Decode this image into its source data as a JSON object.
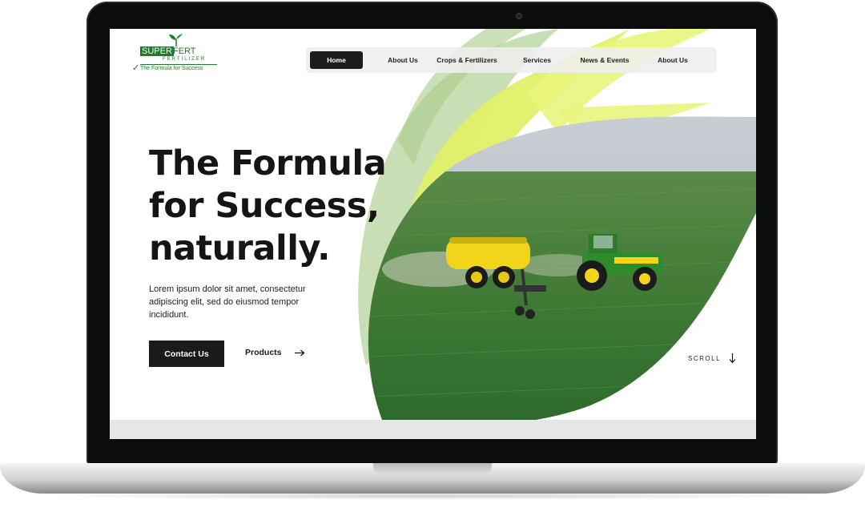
{
  "brand": {
    "word1": "SUPER",
    "word2": "FERT",
    "sub": "FERTILIZER",
    "tagline": "The Formula for Success"
  },
  "nav": {
    "items": [
      {
        "label": "Home",
        "active": true
      },
      {
        "label": "About Us",
        "active": false
      },
      {
        "label": "Crops & Fertilizers",
        "active": false
      },
      {
        "label": "Services",
        "active": false
      },
      {
        "label": "News & Events",
        "active": false
      },
      {
        "label": "About Us",
        "active": false
      }
    ]
  },
  "hero": {
    "headline_line1": "The Formula",
    "headline_line2": "for Success,",
    "headline_line3": "naturally.",
    "body": "Lorem ipsum dolor sit amet, consectetur adipiscing elit, sed do eiusmod tempor incididunt.",
    "cta_label": "Contact Us",
    "secondary_label": "Products",
    "scroll_label": "SCROLL"
  },
  "colors": {
    "brand_green": "#1f7a2e",
    "lime": "#dff05a",
    "sage": "#a8cc8a",
    "dark": "#1a1a1a"
  },
  "icons": {
    "arrow_right": "arrow-right-icon",
    "arrow_down": "arrow-down-icon",
    "logo_sprout": "sprout-icon"
  }
}
